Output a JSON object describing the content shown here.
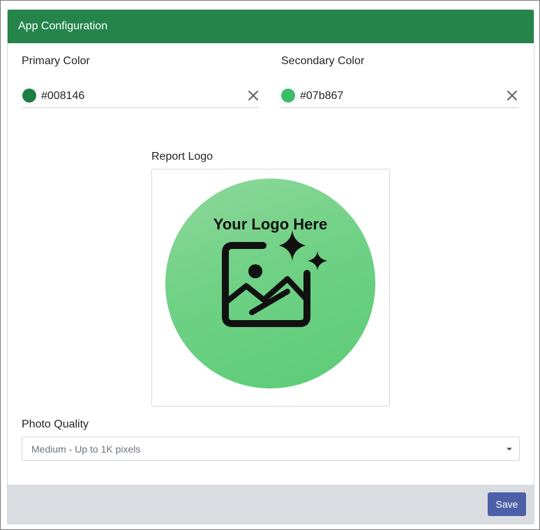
{
  "card": {
    "title": "App Configuration"
  },
  "primary_color": {
    "label": "Primary Color",
    "value": "#008146",
    "swatch_color": "#1e7d45",
    "clear_icon": "close-icon"
  },
  "secondary_color": {
    "label": "Secondary Color",
    "value": "#07b867",
    "swatch_color": "#3dbb6c",
    "clear_icon": "close-icon"
  },
  "report_logo": {
    "label": "Report Logo",
    "placeholder_text": "Your Logo Here",
    "icon": "image-sparkle-icon"
  },
  "photo_quality": {
    "label": "Photo Quality",
    "selected": "Medium - Up to 1K pixels"
  },
  "footer": {
    "save_label": "Save"
  },
  "colors": {
    "header_bg": "#24844a",
    "save_button": "#4d5fa8",
    "footer_bg": "#d9dde1"
  }
}
